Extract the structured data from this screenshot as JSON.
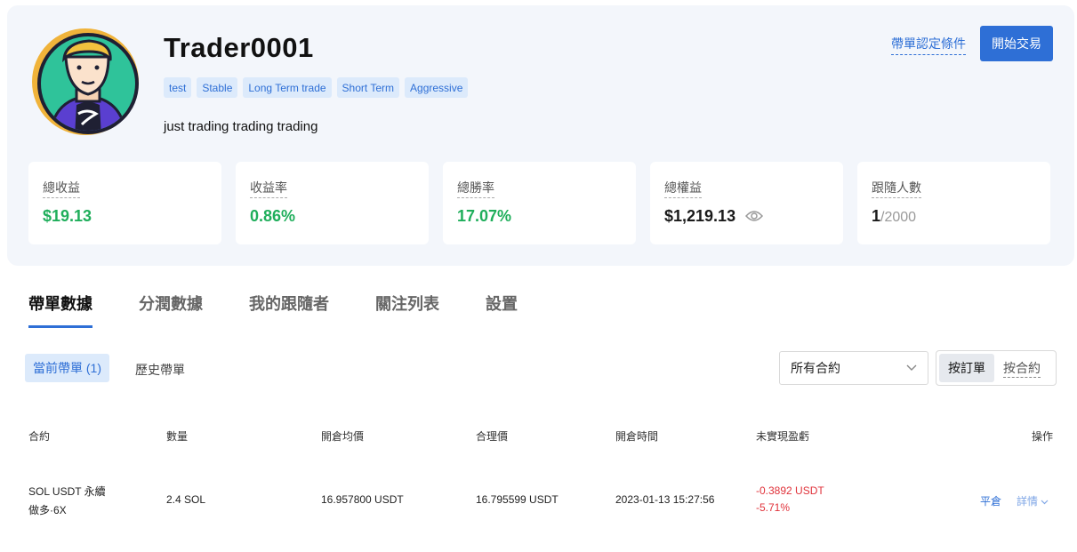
{
  "profile": {
    "name": "Trader0001",
    "tags": [
      "test",
      "Stable",
      "Long Term trade",
      "Short Term",
      "Aggressive"
    ],
    "bio": "just trading trading trading",
    "cert_link": "帶單認定條件",
    "start_button": "開始交易"
  },
  "stats": {
    "total_profit": {
      "label": "總收益",
      "value": "$19.13"
    },
    "return_rate": {
      "label": "收益率",
      "value": "0.86%"
    },
    "win_rate": {
      "label": "總勝率",
      "value": "17.07%"
    },
    "total_equity": {
      "label": "總權益",
      "value": "$1,219.13"
    },
    "followers": {
      "label": "跟隨人數",
      "current": "1",
      "max": "/2000"
    }
  },
  "tabs": [
    "帶單數據",
    "分潤數據",
    "我的跟隨者",
    "關注列表",
    "設置"
  ],
  "subtabs": {
    "current": "當前帶單 (1)",
    "history": "歷史帶單"
  },
  "filter": {
    "contract_select": "所有合約",
    "by_order": "按訂單",
    "by_contract": "按合約"
  },
  "table": {
    "headers": [
      "合約",
      "數量",
      "開倉均價",
      "合理價",
      "開倉時間",
      "未實現盈虧",
      "操作"
    ],
    "rows": [
      {
        "contract": "SOL USDT 永續",
        "direction": "做多·6X",
        "qty": "2.4 SOL",
        "open_price": "16.957800 USDT",
        "fair_price": "16.795599 USDT",
        "open_time": "2023-01-13 15:27:56",
        "pnl": "-0.3892 USDT",
        "pnl_pct": "-5.71%",
        "close_action": "平倉",
        "detail_action": "詳情"
      }
    ]
  },
  "colors": {
    "accent": "#2e6fd6",
    "profit": "#1fae5b",
    "loss": "#e0323a"
  }
}
